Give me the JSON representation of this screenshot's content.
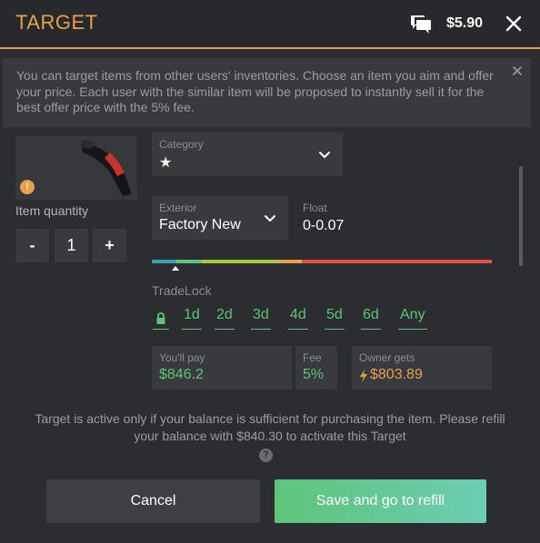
{
  "header": {
    "title": "TARGET",
    "balance": "$5.90",
    "accent_color": "#e8a04a"
  },
  "banner": {
    "text": "You can target items from other users' inventories. Choose an item you aim and offer your price. Each user with the similar item will be proposed to instantly sell it for the best offer price with the 5% fee."
  },
  "item": {
    "warning_badge": "!"
  },
  "quantity": {
    "label": "Item quantity",
    "minus_label": "-",
    "value": "1",
    "plus_label": "+"
  },
  "category": {
    "label": "Category",
    "value": "★"
  },
  "exterior": {
    "label": "Exterior",
    "value": "Factory New"
  },
  "float": {
    "label": "Float",
    "value": "0-0.07",
    "marker_position": 0.07
  },
  "tradelock": {
    "label": "TradeLock",
    "options": [
      "1d",
      "2d",
      "3d",
      "4d",
      "5d",
      "6d",
      "Any"
    ]
  },
  "pricing": {
    "pay_label": "You'll pay",
    "pay_value": "$846.2",
    "fee_label": "Fee",
    "fee_value": "5%",
    "owner_label": "Owner gets",
    "owner_value": "$803.89"
  },
  "note": {
    "text": "Target is active only if your balance is sufficient for purchasing the item. Please refill your balance with $840.30 to activate this Target",
    "help": "?"
  },
  "buttons": {
    "cancel": "Cancel",
    "save": "Save and go to refill"
  },
  "colors": {
    "green": "#5fc47a",
    "orange": "#e8a04a",
    "panel": "#383a3d"
  }
}
